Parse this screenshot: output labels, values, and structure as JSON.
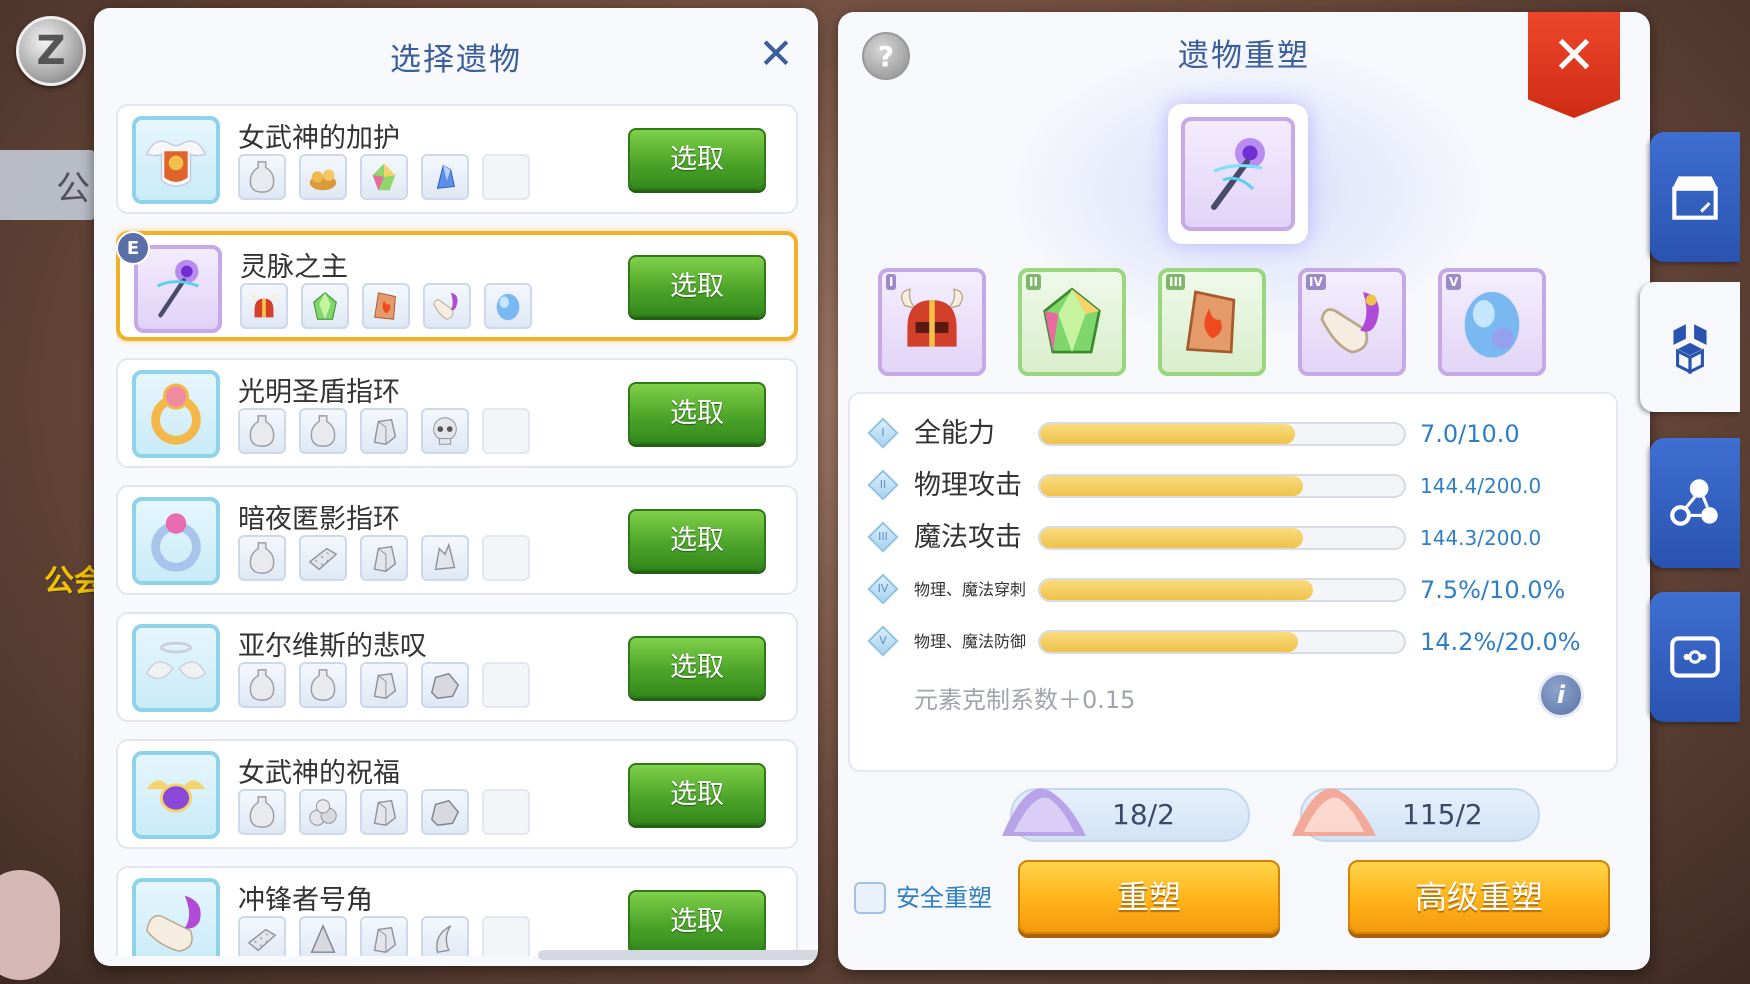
{
  "background": {
    "z_button": "Z",
    "side_tab_text": "公",
    "gold_text": "公会"
  },
  "left_panel": {
    "title": "选择遗物",
    "relics": [
      {
        "name": "女武神的加护",
        "button": "选取",
        "selected": false,
        "icon": "valkyrie-shield-icon",
        "materials": [
          "potion-icon",
          "ore-pile-icon",
          "rainbow-crystal-icon",
          "blue-crystal-icon",
          "empty-slot"
        ]
      },
      {
        "name": "灵脉之主",
        "button": "选取",
        "selected": true,
        "badge": "E",
        "icon": "spirit-staff-icon",
        "materials": [
          "horned-helmet-icon",
          "green-gem-icon",
          "flame-stone-icon",
          "horn-icon",
          "blue-egg-icon"
        ]
      },
      {
        "name": "光明圣盾指环",
        "button": "选取",
        "selected": false,
        "icon": "holy-ring-icon",
        "materials": [
          "potion-icon",
          "potion-icon",
          "stone-icon",
          "skull-icon",
          "empty-slot"
        ]
      },
      {
        "name": "暗夜匿影指环",
        "button": "选取",
        "selected": false,
        "icon": "night-ring-icon",
        "materials": [
          "potion-icon",
          "brick-icon",
          "stone-icon",
          "crystal-shard-icon",
          "empty-slot"
        ]
      },
      {
        "name": "亚尔维斯的悲叹",
        "button": "选取",
        "selected": false,
        "icon": "winged-halo-icon",
        "materials": [
          "potion-icon",
          "potion-icon",
          "stone-icon",
          "rock-icon",
          "empty-slot"
        ]
      },
      {
        "name": "女武神的祝福",
        "button": "选取",
        "selected": false,
        "icon": "winged-gem-icon",
        "materials": [
          "potion-icon",
          "rock-pile-icon",
          "stone-icon",
          "rock-icon",
          "empty-slot"
        ]
      },
      {
        "name": "冲锋者号角",
        "button": "选取",
        "selected": false,
        "icon": "charger-horn-icon",
        "materials": [
          "brick-icon",
          "cone-icon",
          "stone-icon",
          "claw-icon",
          "empty-slot"
        ]
      }
    ]
  },
  "right_panel": {
    "help": "?",
    "title": "遗物重塑",
    "close": "✕",
    "slots": [
      {
        "num": "I",
        "icon": "horned-helmet-icon",
        "color": "purple"
      },
      {
        "num": "II",
        "icon": "green-gem-icon",
        "color": "green"
      },
      {
        "num": "III",
        "icon": "flame-stone-icon",
        "color": "green"
      },
      {
        "num": "IV",
        "icon": "horn-icon",
        "color": "purple"
      },
      {
        "num": "V",
        "icon": "blue-egg-icon",
        "color": "purple"
      }
    ],
    "stats": [
      {
        "num": "I",
        "label": "全能力",
        "value": "7.0/10.0",
        "fill": 0.7,
        "small": false
      },
      {
        "num": "II",
        "label": "物理攻击",
        "value": "144.4/200.0",
        "fill": 0.722,
        "small": false
      },
      {
        "num": "III",
        "label": "魔法攻击",
        "value": "144.3/200.0",
        "fill": 0.7215,
        "small": false
      },
      {
        "num": "IV",
        "label": "物理、魔法穿刺",
        "value": "7.5%/10.0%",
        "fill": 0.75,
        "small": true
      },
      {
        "num": "V",
        "label": "物理、魔法防御",
        "value": "14.2%/20.0%",
        "fill": 0.71,
        "small": true
      }
    ],
    "element_note": "元素克制系数＋0.15",
    "info": "i",
    "materials": [
      {
        "count": "18/2",
        "icon": "purple-dust-icon"
      },
      {
        "count": "115/2",
        "icon": "pink-dust-icon"
      }
    ],
    "safe_reforge": "安全重塑",
    "reforge_button": "重塑",
    "advanced_reforge_button": "高级重塑"
  },
  "side_tabs": [
    "shop-icon",
    "cube-icon",
    "nodes-icon",
    "scan-icon"
  ],
  "colors": {
    "accent_blue": "#3b5e9c",
    "select_green": "#4ea52a",
    "reforge_orange": "#ffb219",
    "selected_border": "#f2b128",
    "stat_value_blue": "#2f7fc6"
  }
}
